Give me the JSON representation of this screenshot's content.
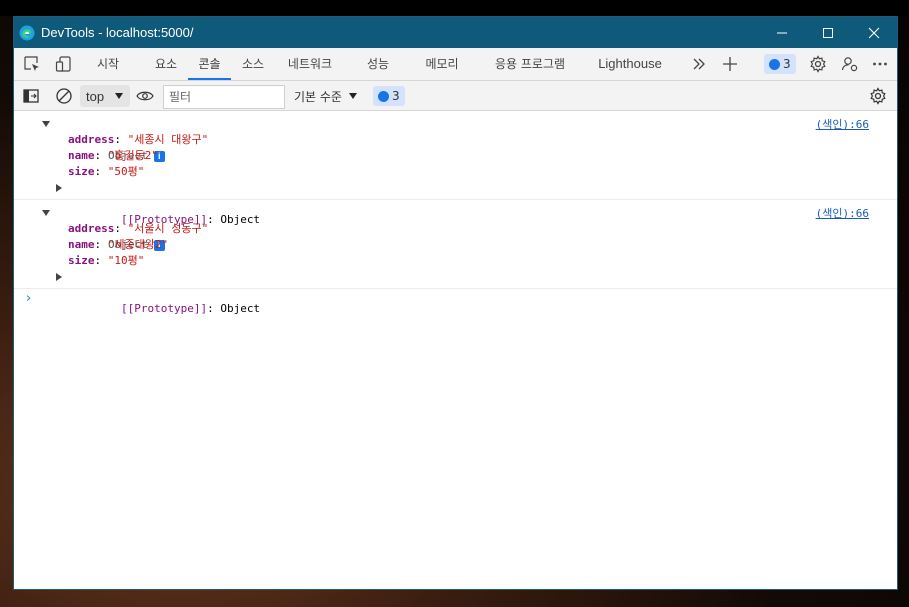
{
  "window": {
    "title": "DevTools - localhost:5000/"
  },
  "tabs": [
    "시작",
    "요소",
    "콘솔",
    "소스",
    "네트워크",
    "성능",
    "메모리",
    "응용 프로그램",
    "Lighthouse"
  ],
  "issues_badge": "3",
  "console_toolbar": {
    "context": "top",
    "filter_placeholder": "필터",
    "levels": "기본 수준",
    "issues_count": "3"
  },
  "messages": [
    {
      "label": "Object",
      "info": "i",
      "source": "(색인):66",
      "props": [
        {
          "key": "address",
          "value": "\"세종시 대왕구\""
        },
        {
          "key": "name",
          "value": "\"홍길동2\""
        },
        {
          "key": "size",
          "value": "\"50평\""
        }
      ],
      "prototype_key": "[[Prototype]]",
      "prototype_value": ": Object"
    },
    {
      "label": "Object",
      "info": "i",
      "source": "(색인):66",
      "props": [
        {
          "key": "address",
          "value": "\"서울시 성동구\""
        },
        {
          "key": "name",
          "value": "\"세종대왕2\""
        },
        {
          "key": "size",
          "value": "\"10평\""
        }
      ],
      "prototype_key": "[[Prototype]]",
      "prototype_value": ": Object"
    }
  ],
  "prompt_symbol": "›",
  "colors": {
    "titlebar": "#0f5a7a",
    "accent": "#1a73e8",
    "key": "#881280",
    "string": "#c41a16"
  }
}
